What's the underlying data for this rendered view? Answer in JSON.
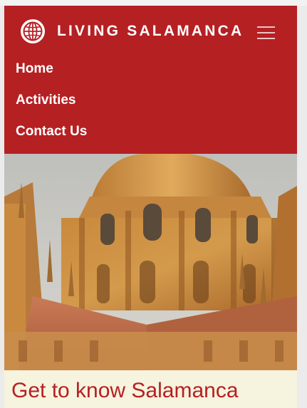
{
  "brand": {
    "logo_icon": "globe-icon",
    "title": "LIVING SALAMANCA"
  },
  "menu_toggle": {
    "icon": "hamburger-icon"
  },
  "nav": {
    "items": [
      {
        "label": "Home"
      },
      {
        "label": "Activities"
      },
      {
        "label": "Contact Us"
      }
    ]
  },
  "hero": {
    "subject": "Salamanca cathedral dome"
  },
  "intro": {
    "title": "Get to know Salamanca"
  },
  "colors": {
    "nav_background": "#b52023",
    "page_background": "#f6f3de",
    "title_color": "#b52023"
  }
}
